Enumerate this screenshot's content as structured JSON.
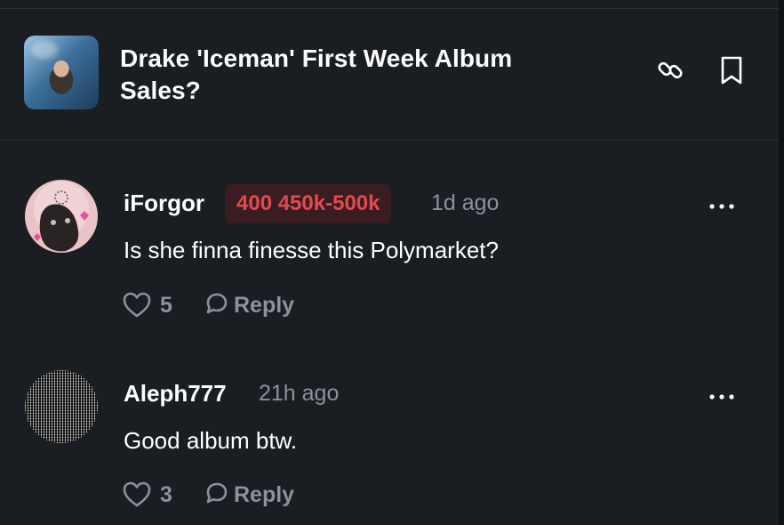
{
  "market": {
    "title": "Drake 'Iceman' First Week Album Sales?"
  },
  "header": {
    "link_icon": "link-icon",
    "bookmark_icon": "bookmark-icon"
  },
  "comments": [
    {
      "username": "iForgor",
      "position_badge": "400 450k-500k",
      "timestamp": "1d ago",
      "body": "Is she finna finesse this Polymarket?",
      "likes": "5",
      "reply_label": "Reply"
    },
    {
      "username": "Aleph777",
      "timestamp": "21h ago",
      "body": "Good album btw.",
      "likes": "3",
      "reply_label": "Reply"
    }
  ],
  "colors": {
    "background": "#1a1d22",
    "muted_text": "#8a929c",
    "badge_text": "#e5484d",
    "badge_bg": "#3a1d22"
  }
}
